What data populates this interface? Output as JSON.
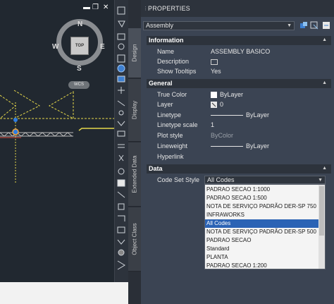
{
  "palette": {
    "title": "PROPERTIES",
    "selection": "Assembly",
    "tabs": [
      "Design",
      "Display",
      "Extended Data",
      "Object Class"
    ]
  },
  "sections": {
    "information": "Information",
    "general": "General",
    "data": "Data"
  },
  "information_rows": [
    {
      "label": "Name",
      "value": "ASSEMBLY BASICO"
    },
    {
      "label": "Description",
      "value": ""
    },
    {
      "label": "Show Tooltips",
      "value": "Yes"
    }
  ],
  "general_rows": [
    {
      "label": "True Color",
      "value": "ByLayer"
    },
    {
      "label": "Layer",
      "value": "0"
    },
    {
      "label": "Linetype",
      "value": "ByLayer"
    },
    {
      "label": "Linetype scale",
      "value": "1"
    },
    {
      "label": "Plot style",
      "value": "ByColor"
    },
    {
      "label": "Lineweight",
      "value": "ByLayer"
    },
    {
      "label": "Hyperlink",
      "value": ""
    }
  ],
  "data_rows": [
    {
      "label": "Code Set Style",
      "value": "All Codes"
    }
  ],
  "code_set_options": [
    "PADRAO SECAO 1:1000",
    "PADRAO SECAO 1:500",
    "NOTA DE SERVIÇO PADRÃO DER-SP 750",
    "INFRAWORKS",
    "All Codes",
    "NOTA DE SERVIÇO PADRÃO DER-SP 500",
    "PADRAO SECAO",
    "Standard",
    "PLANTA",
    "PADRAO SECAO 1:200"
  ],
  "selected_option": "All Codes",
  "viewcube": {
    "top": "TOP",
    "north": "N",
    "south": "S",
    "east": "E",
    "west": "W",
    "wcs": "WCS"
  },
  "colors": {
    "accent_selection": "#2b63b5",
    "palette_bg": "#3b4453",
    "canvas_bg": "#212830",
    "assembly_yellow": "#e6d84a"
  }
}
